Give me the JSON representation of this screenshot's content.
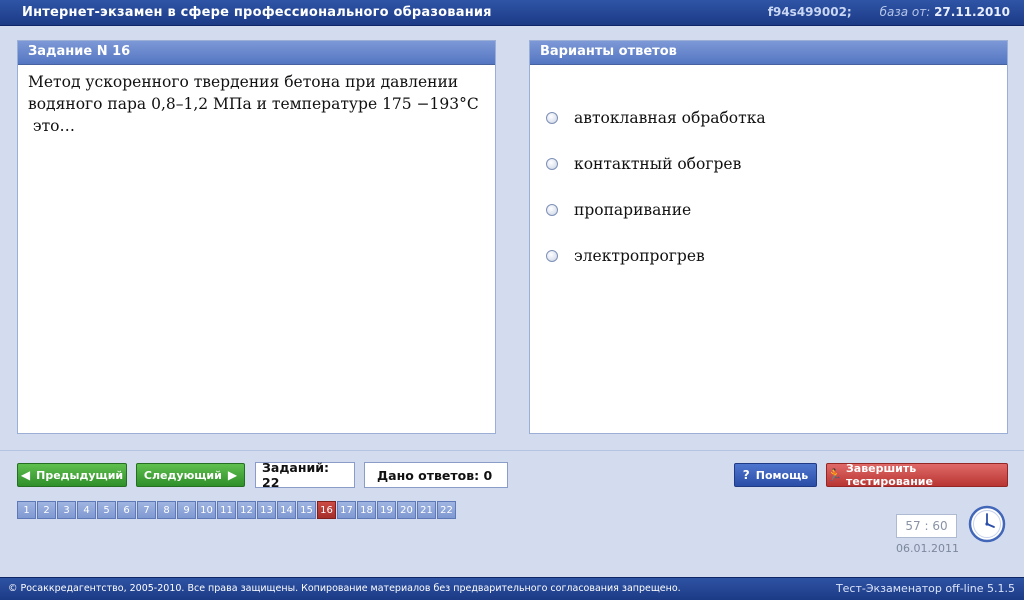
{
  "header": {
    "title": "Интернет-экзамен в сфере профессионального образования",
    "code": "f94s499002;",
    "db_label": "база от:",
    "db_date": "27.11.2010"
  },
  "task": {
    "heading": "Задание N 16",
    "text_line1": "Метод ускоренного твердения бетона при давлении",
    "text_line2": "водяного пара 0,8–1,2 МПа и температуре 175 −193°С",
    "text_line3": " это…"
  },
  "answers": {
    "heading": "Варианты ответов",
    "options": [
      "автоклавная обработка",
      "контактный обогрев",
      "пропаривание",
      "электропрогрев"
    ]
  },
  "controls": {
    "prev_label": "Предыдущий",
    "next_label": "Следующий",
    "tasks_count": "Заданий: 22",
    "answers_given": "Дано ответов: 0",
    "help_label": "Помощь",
    "finish_label": "Завершить тестирование"
  },
  "pages": [
    "1",
    "2",
    "3",
    "4",
    "5",
    "6",
    "7",
    "8",
    "9",
    "10",
    "11",
    "12",
    "13",
    "14",
    "15",
    "16",
    "17",
    "18",
    "19",
    "20",
    "21",
    "22"
  ],
  "current_page": "16",
  "timer": {
    "value": "57 : 60",
    "date": "06.01.2011"
  },
  "footer": {
    "copyright": "© Росаккредагентство, 2005-2010. Все права защищены. Копирование материалов без предварительного согласования запрещено.",
    "version": "Тест-Экзаменатор off-line 5.1.5"
  },
  "colors": {
    "accent_blue": "#2a4ea8",
    "accent_green": "#2f8f2a",
    "accent_red": "#b83532"
  }
}
